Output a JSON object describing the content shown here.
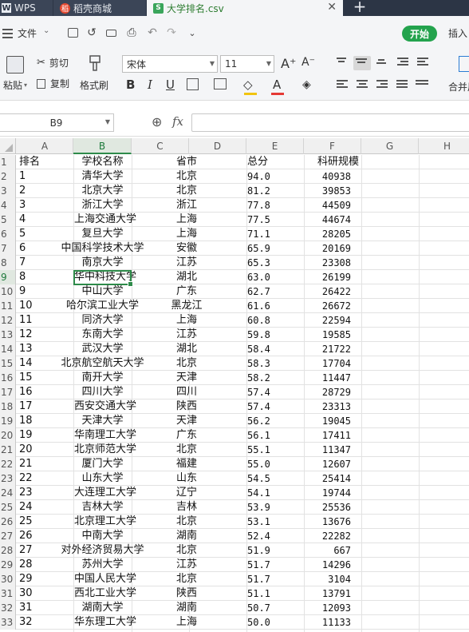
{
  "tabs": {
    "wps": {
      "logo": "W",
      "label": "WPS"
    },
    "store": {
      "logo": "稻",
      "label": "稻壳商城"
    },
    "csv": {
      "logo": "S",
      "label": "大学排名.csv",
      "close": "✕"
    },
    "new_tab": "+"
  },
  "menu": {
    "file_label": "文件",
    "start_label": "开始",
    "insert_label": "插入"
  },
  "ribbon": {
    "paste_label": "粘贴",
    "cut_label": "剪切",
    "copy_label": "复制",
    "format_painter_label": "格式刷",
    "font_name": "宋体",
    "font_size": "11",
    "grow_font": "A⁺",
    "shrink_font": "A⁻",
    "bold": "B",
    "italic": "I",
    "underline": "U",
    "font_color_glyph": "A",
    "merge_label": "合并居",
    "fill_color": "#f1c40f",
    "font_color": "#e53935"
  },
  "formula_bar": {
    "cell_ref": "B9",
    "zoom_glyph": "⊕",
    "fx": "fx",
    "value": ""
  },
  "columns": [
    "A",
    "B",
    "C",
    "D",
    "E",
    "F",
    "G",
    "H"
  ],
  "active_column": "B",
  "active_row": "9",
  "header_row": {
    "row": "1",
    "a": "排名",
    "b": "学校名称",
    "c": "省市",
    "e": "总分",
    "f": "科研规模"
  },
  "rows": [
    {
      "row": "2",
      "rank": "1",
      "name": "清华大学",
      "prov": "北京",
      "score": "94.0",
      "res": "40938"
    },
    {
      "row": "3",
      "rank": "2",
      "name": "北京大学",
      "prov": "北京",
      "score": "81.2",
      "res": "39853"
    },
    {
      "row": "4",
      "rank": "3",
      "name": "浙江大学",
      "prov": "浙江",
      "score": "77.8",
      "res": "44509"
    },
    {
      "row": "5",
      "rank": "4",
      "name": "上海交通大学",
      "prov": "上海",
      "score": "77.5",
      "res": "44674"
    },
    {
      "row": "6",
      "rank": "5",
      "name": "复旦大学",
      "prov": "上海",
      "score": "71.1",
      "res": "28205"
    },
    {
      "row": "7",
      "rank": "6",
      "name": "中国科学技术大学",
      "prov": "安徽",
      "score": "65.9",
      "res": "20169"
    },
    {
      "row": "8",
      "rank": "7",
      "name": "南京大学",
      "prov": "江苏",
      "score": "65.3",
      "res": "23308"
    },
    {
      "row": "9",
      "rank": "8",
      "name": "华中科技大学",
      "prov": "湖北",
      "score": "63.0",
      "res": "26199"
    },
    {
      "row": "10",
      "rank": "9",
      "name": "中山大学",
      "prov": "广东",
      "score": "62.7",
      "res": "26422"
    },
    {
      "row": "11",
      "rank": "10",
      "name": "哈尔滨工业大学",
      "prov": "黑龙江",
      "score": "61.6",
      "res": "26672"
    },
    {
      "row": "12",
      "rank": "11",
      "name": "同济大学",
      "prov": "上海",
      "score": "60.8",
      "res": "22594"
    },
    {
      "row": "13",
      "rank": "12",
      "name": "东南大学",
      "prov": "江苏",
      "score": "59.8",
      "res": "19585"
    },
    {
      "row": "14",
      "rank": "13",
      "name": "武汉大学",
      "prov": "湖北",
      "score": "58.4",
      "res": "21722"
    },
    {
      "row": "15",
      "rank": "14",
      "name": "北京航空航天大学",
      "prov": "北京",
      "score": "58.3",
      "res": "17704"
    },
    {
      "row": "16",
      "rank": "15",
      "name": "南开大学",
      "prov": "天津",
      "score": "58.2",
      "res": "11447"
    },
    {
      "row": "17",
      "rank": "16",
      "name": "四川大学",
      "prov": "四川",
      "score": "57.4",
      "res": "28729"
    },
    {
      "row": "18",
      "rank": "17",
      "name": "西安交通大学",
      "prov": "陕西",
      "score": "57.4",
      "res": "23313"
    },
    {
      "row": "19",
      "rank": "18",
      "name": "天津大学",
      "prov": "天津",
      "score": "56.2",
      "res": "19045"
    },
    {
      "row": "20",
      "rank": "19",
      "name": "华南理工大学",
      "prov": "广东",
      "score": "56.1",
      "res": "17411"
    },
    {
      "row": "21",
      "rank": "20",
      "name": "北京师范大学",
      "prov": "北京",
      "score": "55.1",
      "res": "11347"
    },
    {
      "row": "22",
      "rank": "21",
      "name": "厦门大学",
      "prov": "福建",
      "score": "55.0",
      "res": "12607"
    },
    {
      "row": "23",
      "rank": "22",
      "name": "山东大学",
      "prov": "山东",
      "score": "54.5",
      "res": "25414"
    },
    {
      "row": "24",
      "rank": "23",
      "name": "大连理工大学",
      "prov": "辽宁",
      "score": "54.1",
      "res": "19744"
    },
    {
      "row": "25",
      "rank": "24",
      "name": "吉林大学",
      "prov": "吉林",
      "score": "53.9",
      "res": "25536"
    },
    {
      "row": "26",
      "rank": "25",
      "name": "北京理工大学",
      "prov": "北京",
      "score": "53.1",
      "res": "13676"
    },
    {
      "row": "27",
      "rank": "26",
      "name": "中南大学",
      "prov": "湖南",
      "score": "52.4",
      "res": "22282"
    },
    {
      "row": "28",
      "rank": "27",
      "name": "对外经济贸易大学",
      "prov": "北京",
      "score": "51.9",
      "res": "667"
    },
    {
      "row": "29",
      "rank": "28",
      "name": "苏州大学",
      "prov": "江苏",
      "score": "51.7",
      "res": "14296"
    },
    {
      "row": "30",
      "rank": "29",
      "name": "中国人民大学",
      "prov": "北京",
      "score": "51.7",
      "res": "3104"
    },
    {
      "row": "31",
      "rank": "30",
      "name": "西北工业大学",
      "prov": "陕西",
      "score": "51.1",
      "res": "13791"
    },
    {
      "row": "32",
      "rank": "31",
      "name": "湖南大学",
      "prov": "湖南",
      "score": "50.7",
      "res": "12093"
    },
    {
      "row": "33",
      "rank": "32",
      "name": "华东理工大学",
      "prov": "上海",
      "score": "50.0",
      "res": "11133"
    }
  ]
}
